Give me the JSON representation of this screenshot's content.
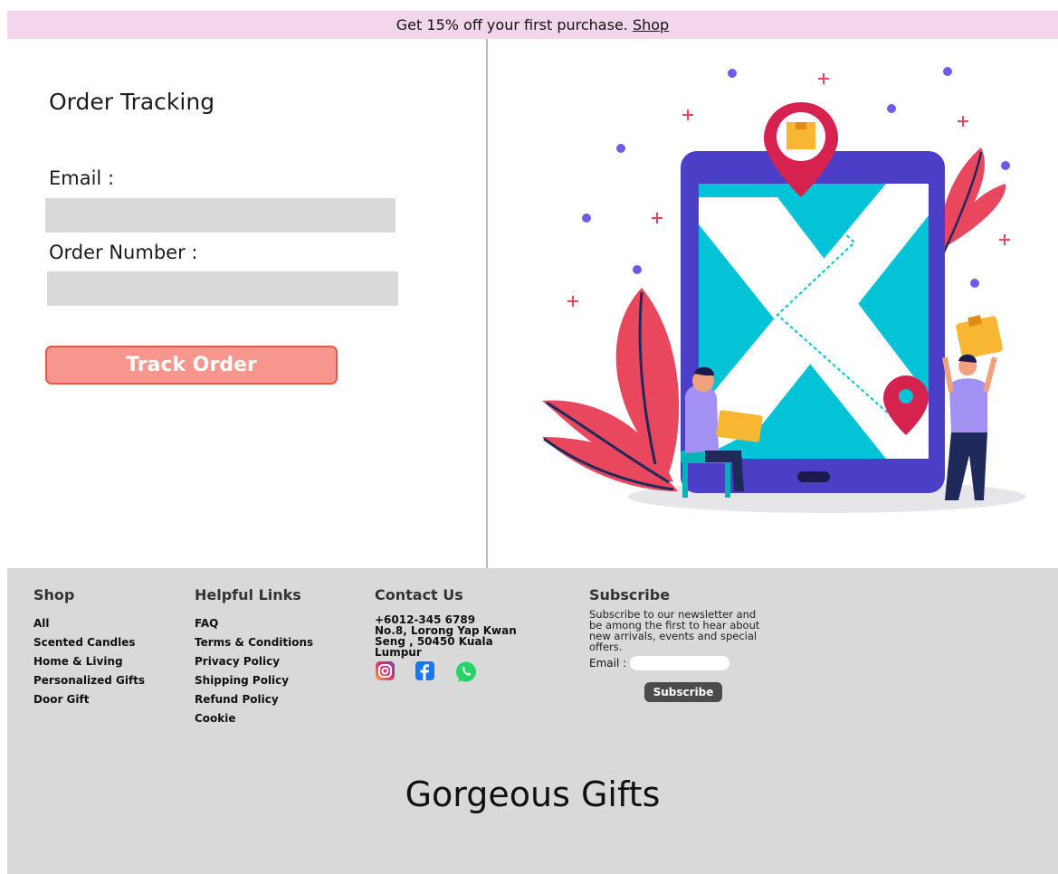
{
  "promo": {
    "text": "Get 15% off your first purchase. ",
    "link": "Shop"
  },
  "tracking": {
    "title": "Order Tracking",
    "email_label": "Email :",
    "email_value": "",
    "order_label": "Order Number :",
    "order_value": "",
    "button": "Track Order"
  },
  "illustration": {
    "name": "order-tracking-illustration"
  },
  "footer": {
    "shop": {
      "heading": "Shop",
      "items": [
        "All",
        "Scented Candles",
        "Home & Living",
        "Personalized Gifts",
        "Door Gift"
      ]
    },
    "helpful": {
      "heading": "Helpful Links",
      "items": [
        "FAQ",
        "Terms & Conditions",
        "Privacy Policy",
        "Shipping Policy",
        "Refund Policy",
        "Cookie"
      ]
    },
    "contact": {
      "heading": "Contact Us",
      "phone": "+6012-345 6789",
      "address_lines": [
        "No.8, Lorong Yap Kwan",
        "Seng , 50450 Kuala",
        "Lumpur"
      ],
      "social_icons": [
        "instagram-icon",
        "facebook-icon",
        "whatsapp-icon"
      ]
    },
    "subscribe": {
      "heading": "Subscribe",
      "lines": [
        "Subscribe to our newsletter and",
        "be among the first to hear about",
        "new arrivals, events and special",
        "offers."
      ],
      "email_label": "Email :",
      "email_value": "",
      "button": "Subscribe"
    },
    "brand": "Gorgeous Gifts"
  },
  "colors": {
    "promo_bg": "#f3d6ec",
    "footer_bg": "#d9d9d9",
    "button_fill": "#f7968c",
    "button_border": "#e25a4c",
    "input_bg": "#d9d9d9"
  }
}
